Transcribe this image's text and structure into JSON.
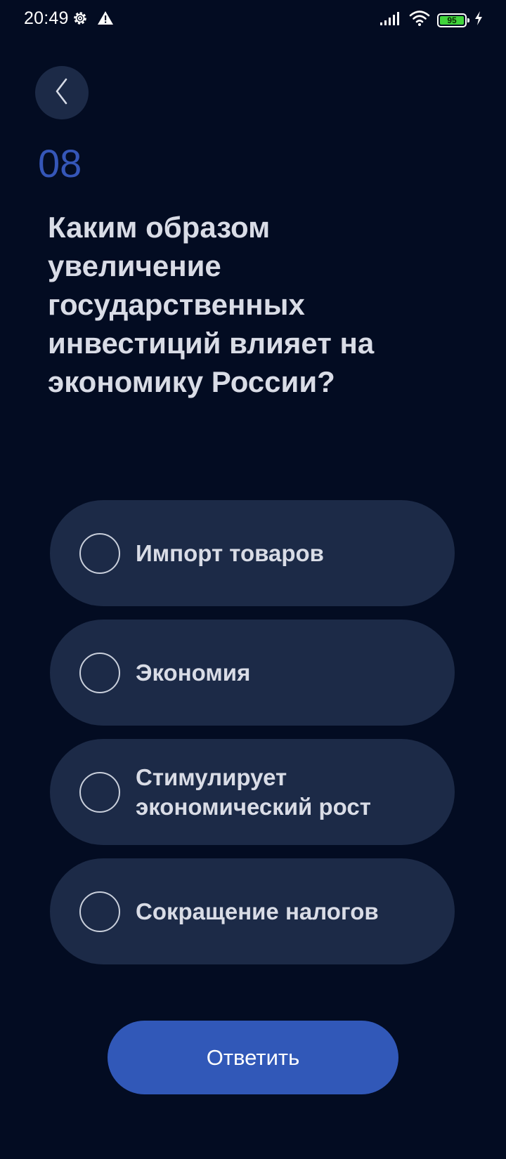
{
  "status_bar": {
    "time": "20:49",
    "battery_level": "95",
    "icons": [
      "gear-icon",
      "warning-icon",
      "signal-icon",
      "wifi-icon",
      "battery-icon",
      "charging-icon"
    ]
  },
  "question": {
    "number": "08",
    "text": "Каким образом увеличение государственных инвестиций влияет на экономику России?"
  },
  "answers": [
    {
      "label": "Импорт товаров",
      "selected": false
    },
    {
      "label": "Экономия",
      "selected": false
    },
    {
      "label": "Стимулирует экономический рост",
      "selected": false
    },
    {
      "label": "Сокращение налогов",
      "selected": false
    }
  ],
  "submit_label": "Ответить",
  "colors": {
    "background": "#030c22",
    "card": "#1c2a47",
    "accent": "#3158b8",
    "number": "#3556b8",
    "text": "#d9dce6"
  }
}
